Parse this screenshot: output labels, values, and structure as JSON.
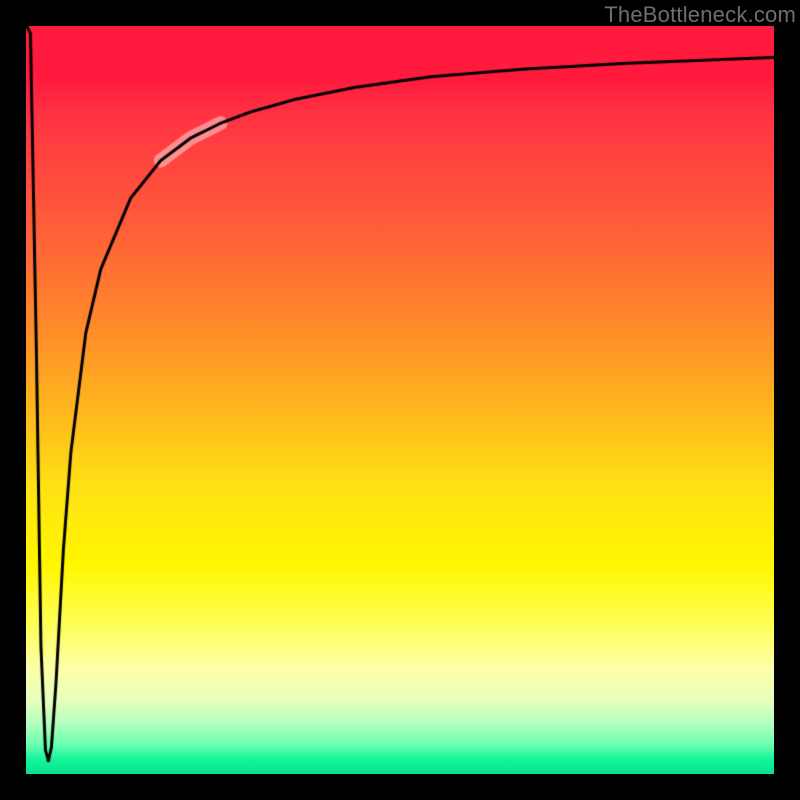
{
  "attribution": "TheBottleneck.com",
  "chart_data": {
    "type": "line",
    "title": "",
    "xlabel": "",
    "ylabel": "",
    "xlim": [
      0,
      100
    ],
    "ylim": [
      0,
      100
    ],
    "axes_visible": false,
    "grid": false,
    "background_gradient": {
      "direction": "top-to-bottom",
      "stops": [
        {
          "pos": 0.0,
          "color": "#ff1a3e"
        },
        {
          "pos": 0.5,
          "color": "#ffb400"
        },
        {
          "pos": 0.75,
          "color": "#fff600"
        },
        {
          "pos": 0.95,
          "color": "#9cffb0"
        },
        {
          "pos": 1.0,
          "color": "#04e28e"
        }
      ]
    },
    "series": [
      {
        "name": "main-curve",
        "color": "#000000",
        "stroke_width": 3,
        "x": [
          0.1,
          0.6,
          1.4,
          2.0,
          2.6,
          3.0,
          3.4,
          4.0,
          5.0,
          6.0,
          8.0,
          10.0,
          14.0,
          18.0,
          22.0,
          26.0,
          30.0,
          36.0,
          44.0,
          54.0,
          66.0,
          80.0,
          100.0
        ],
        "y": [
          100.0,
          99.0,
          56.0,
          17.0,
          3.2,
          1.8,
          3.6,
          12.0,
          30.0,
          43.0,
          59.0,
          67.5,
          77.0,
          82.0,
          85.0,
          87.0,
          88.5,
          90.2,
          91.8,
          93.2,
          94.2,
          95.0,
          95.8
        ]
      }
    ],
    "highlight_segment": {
      "series": "main-curve",
      "x_start": 18.0,
      "x_end": 26.0,
      "color": "rgba(255,255,255,0.42)",
      "stroke_width": 14
    }
  }
}
